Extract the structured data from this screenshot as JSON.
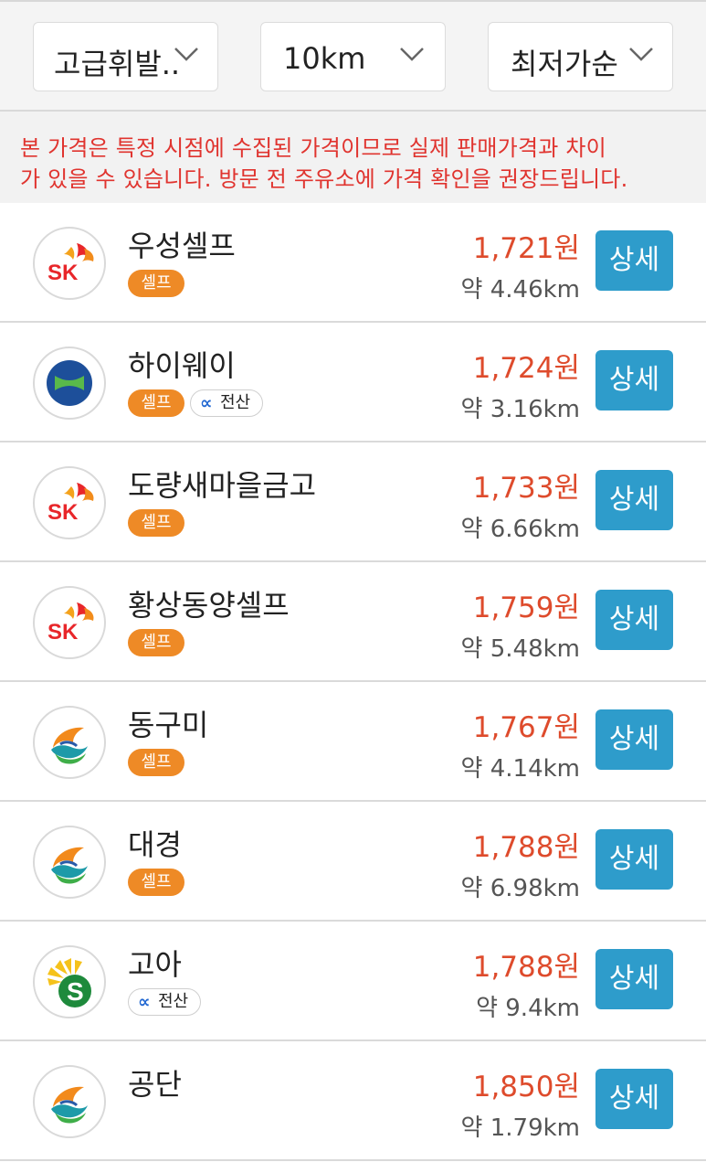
{
  "filters": [
    {
      "label": "고급휘발유",
      "display": "고급휘발.."
    },
    {
      "label": "10km"
    },
    {
      "label": "최저가순"
    }
  ],
  "notice": {
    "line1": "본 가격은 특정 시점에 수집된 가격이므로 실제 판매가격과 차이",
    "line2": "가 있을 수 있습니다. 방문 전 주유소에 가격 확인을 권장드립니다."
  },
  "labels": {
    "self_badge": "셀프",
    "electronic_badge": "전산",
    "electronic_badge_icon": "ok",
    "detail_button": "상세"
  },
  "colors": {
    "price": "#de4b2c",
    "self_badge": "#ee8a26",
    "detail_button": "#2e9ccb",
    "notice_text": "#e0342f"
  },
  "stations": [
    {
      "brand": "sk-logo",
      "name": "우성셀프",
      "price": "1,721원",
      "distance": "약 4.46km",
      "self": true,
      "electronic": false
    },
    {
      "brand": "hyundai-oilbank-logo",
      "name": "하이웨이",
      "price": "1,724원",
      "distance": "약 3.16km",
      "self": true,
      "electronic": true
    },
    {
      "brand": "sk-logo",
      "name": "도량새마을금고",
      "price": "1,733원",
      "distance": "약 6.66km",
      "self": true,
      "electronic": false
    },
    {
      "brand": "sk-logo",
      "name": "황상동양셀프",
      "price": "1,759원",
      "distance": "약 5.48km",
      "self": true,
      "electronic": false
    },
    {
      "brand": "gs-caltex-logo",
      "name": "동구미",
      "price": "1,767원",
      "distance": "약 4.14km",
      "self": true,
      "electronic": false
    },
    {
      "brand": "gs-caltex-logo",
      "name": "대경",
      "price": "1,788원",
      "distance": "약 6.98km",
      "self": true,
      "electronic": false
    },
    {
      "brand": "s-oil-logo",
      "name": "고아",
      "price": "1,788원",
      "distance": "약 9.4km",
      "self": false,
      "electronic": true
    },
    {
      "brand": "gs-caltex-logo",
      "name": "공단",
      "price": "1,850원",
      "distance": "약 1.79km",
      "self": false,
      "electronic": false
    }
  ]
}
